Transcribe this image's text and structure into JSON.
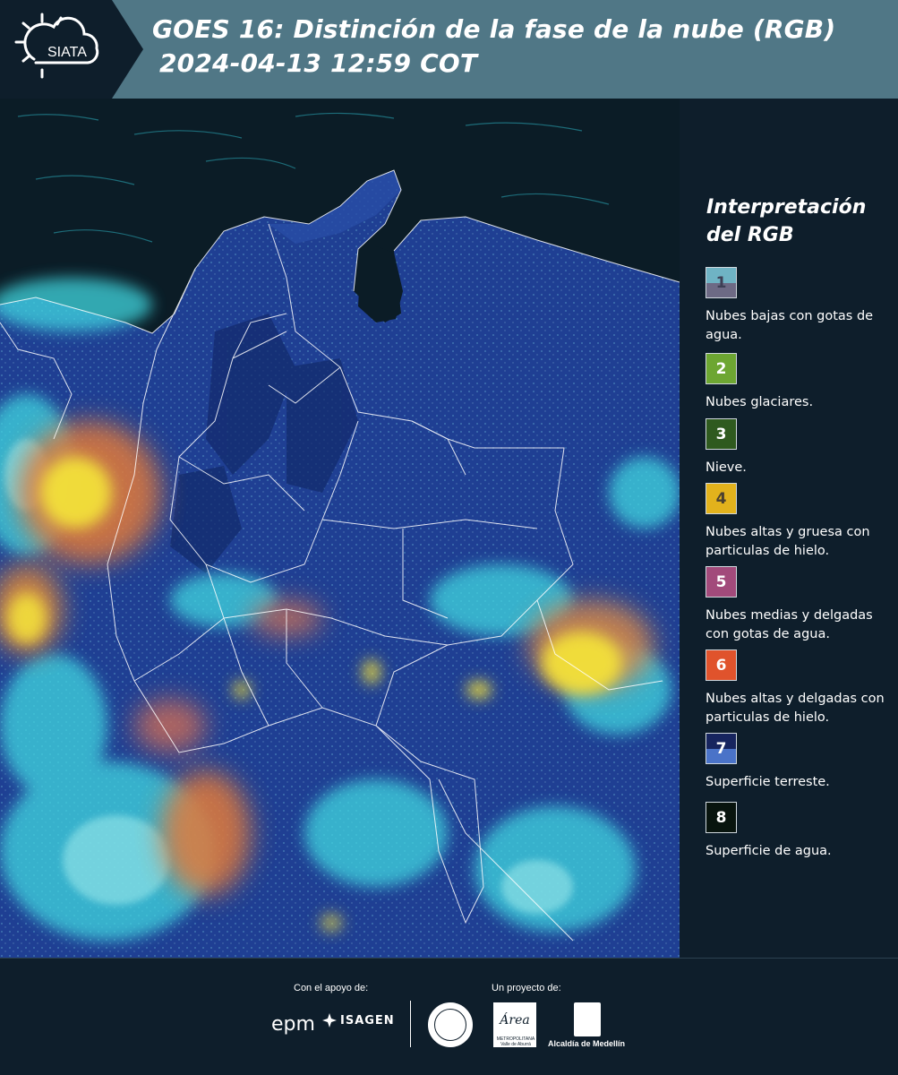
{
  "header": {
    "logo_text": "SIATA",
    "title_line1": "GOES 16: Distinción de la fase de la nube (RGB)",
    "title_line2": "2024-04-13 12:59 COT"
  },
  "legend": {
    "title": "Interpretación del RGB",
    "items": [
      {
        "number": "1",
        "colors": [
          "#6fb3c4",
          "#6d6a85"
        ],
        "description": "Nubes bajas con gotas de agua."
      },
      {
        "number": "2",
        "colors": [
          "#6da632"
        ],
        "description": "Nubes glaciares."
      },
      {
        "number": "3",
        "colors": [
          "#2f5a1f"
        ],
        "description": "Nieve."
      },
      {
        "number": "4",
        "colors": [
          "#e2b21c"
        ],
        "description": "Nubes altas y gruesa con particulas de hielo."
      },
      {
        "number": "5",
        "colors": [
          "#a24a7b"
        ],
        "description": "Nubes medias y delgadas con gotas de agua."
      },
      {
        "number": "6",
        "colors": [
          "#e0532c"
        ],
        "description": "Nubes altas y delgadas con particulas de hielo."
      },
      {
        "number": "7",
        "colors": [
          "#17255f",
          "#4a73c8"
        ],
        "description": "Superficie terreste."
      },
      {
        "number": "8",
        "colors": [
          "#08140e"
        ],
        "description": "Superficie de agua."
      }
    ]
  },
  "footer": {
    "support_label": "Con el apoyo de:",
    "project_label": "Un proyecto de:",
    "epm_text": "epm",
    "isagen_text": "ISAGEN",
    "area_text": "Área",
    "area_subtext": "METROPOLITANA Valle de Aburrá",
    "alcaldia_text": "Alcaldía de Medellín"
  },
  "colors": {
    "header_bg": "#507786",
    "page_bg": "#0e1e2b",
    "land": "#1f3f93",
    "ocean": "#0b1c26",
    "cloud_cyan": "#3fd7e0",
    "cloud_yellow": "#f2e03a",
    "cloud_orange": "#e27a3a"
  }
}
